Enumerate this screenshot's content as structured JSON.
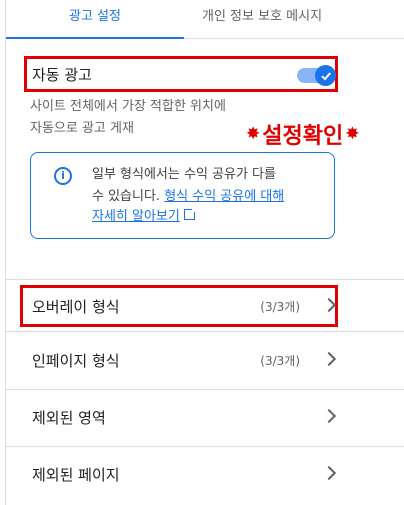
{
  "tabs": [
    {
      "label": "광고 설정"
    },
    {
      "label": "개인 정보 보호 메시지"
    }
  ],
  "auto_ads": {
    "label": "자동 광고",
    "enabled": true,
    "description_line1": "사이트 전체에서 가장 적합한 위치에",
    "description_line2": "자동으로 광고 게재"
  },
  "annotation": {
    "text": "설정확인",
    "color": "#e00000"
  },
  "info": {
    "line1": "일부 형식에서는 수익 공유가 다를",
    "line2_text": "수 있습니다. ",
    "line2_link": "형식 수익 공유에 대해",
    "line3_link": "자세히 알아보기"
  },
  "rows": [
    {
      "label": "오버레이 형식",
      "count": "(3/3개)"
    },
    {
      "label": "인페이지 형식",
      "count": "(3/3개)"
    },
    {
      "label": "제외된 영역",
      "count": ""
    },
    {
      "label": "제외된 페이지",
      "count": ""
    }
  ],
  "colors": {
    "accent": "#1a73e8",
    "highlight": "#e00000"
  }
}
